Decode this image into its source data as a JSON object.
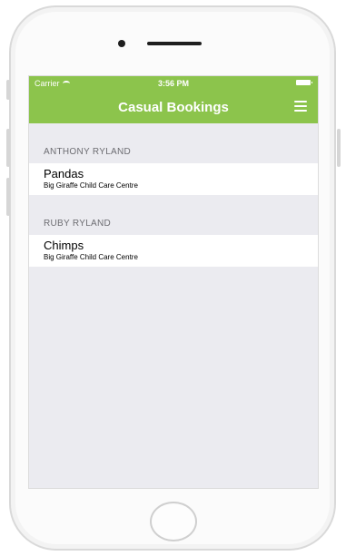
{
  "status_bar": {
    "carrier": "Carrier",
    "time": "3:56 PM"
  },
  "navbar": {
    "title": "Casual Bookings"
  },
  "sections": [
    {
      "header": "ANTHONY RYLAND",
      "items": [
        {
          "title": "Pandas",
          "subtitle": "Big Giraffe Child Care Centre"
        }
      ]
    },
    {
      "header": "RUBY RYLAND",
      "items": [
        {
          "title": "Chimps",
          "subtitle": "Big Giraffe Child Care Centre"
        }
      ]
    }
  ],
  "colors": {
    "navbar": "#8cc44c",
    "background": "#ebebf0",
    "section_header_text": "#6d6d72"
  },
  "icons": {
    "menu": "hamburger-icon",
    "wifi": "wifi-icon",
    "battery": "battery-icon"
  }
}
